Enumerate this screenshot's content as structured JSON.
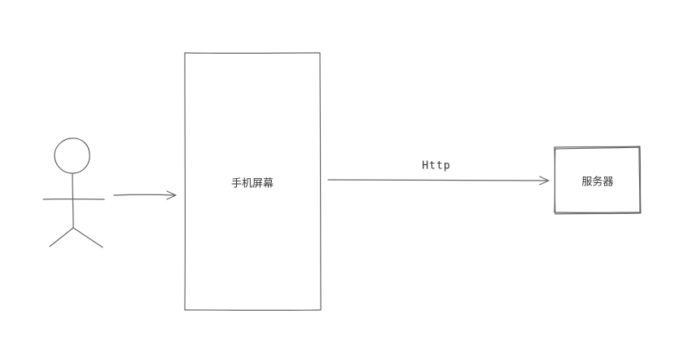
{
  "nodes": {
    "phone_screen": {
      "label": "手机屏幕"
    },
    "server": {
      "label": "服务器"
    }
  },
  "edges": {
    "http": {
      "label": "Http"
    }
  },
  "colors": {
    "stroke": "#666666",
    "text": "#333333",
    "background": "#ffffff"
  }
}
